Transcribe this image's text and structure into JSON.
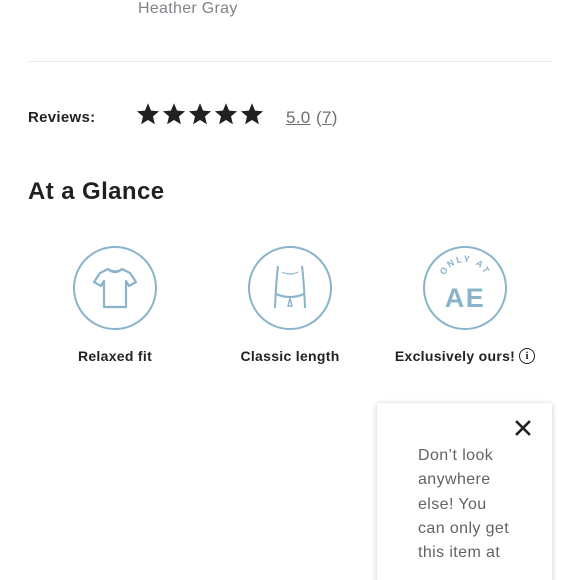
{
  "product": {
    "color_name": "Heather Gray"
  },
  "reviews": {
    "label": "Reviews:",
    "rating": "5.0",
    "count_open": "(",
    "count": "7",
    "count_close": ")",
    "stars_filled": 5,
    "stars_total": 5
  },
  "at_a_glance": {
    "title": "At a Glance",
    "features": [
      {
        "label": "Relaxed fit",
        "icon": "tshirt-icon"
      },
      {
        "label": "Classic length",
        "icon": "torso-length-icon"
      },
      {
        "label": "Exclusively ours!",
        "icon": "only-at-ae-icon",
        "badge_arc_text": "ONLY AT",
        "badge_text": "AE"
      }
    ]
  },
  "tooltip": {
    "text": "Don’t look anywhere else! You can only get this item at"
  },
  "colors": {
    "badge_outline": "#8ab4c9",
    "text_primary": "#1f2123",
    "text_muted": "#6b7076"
  }
}
